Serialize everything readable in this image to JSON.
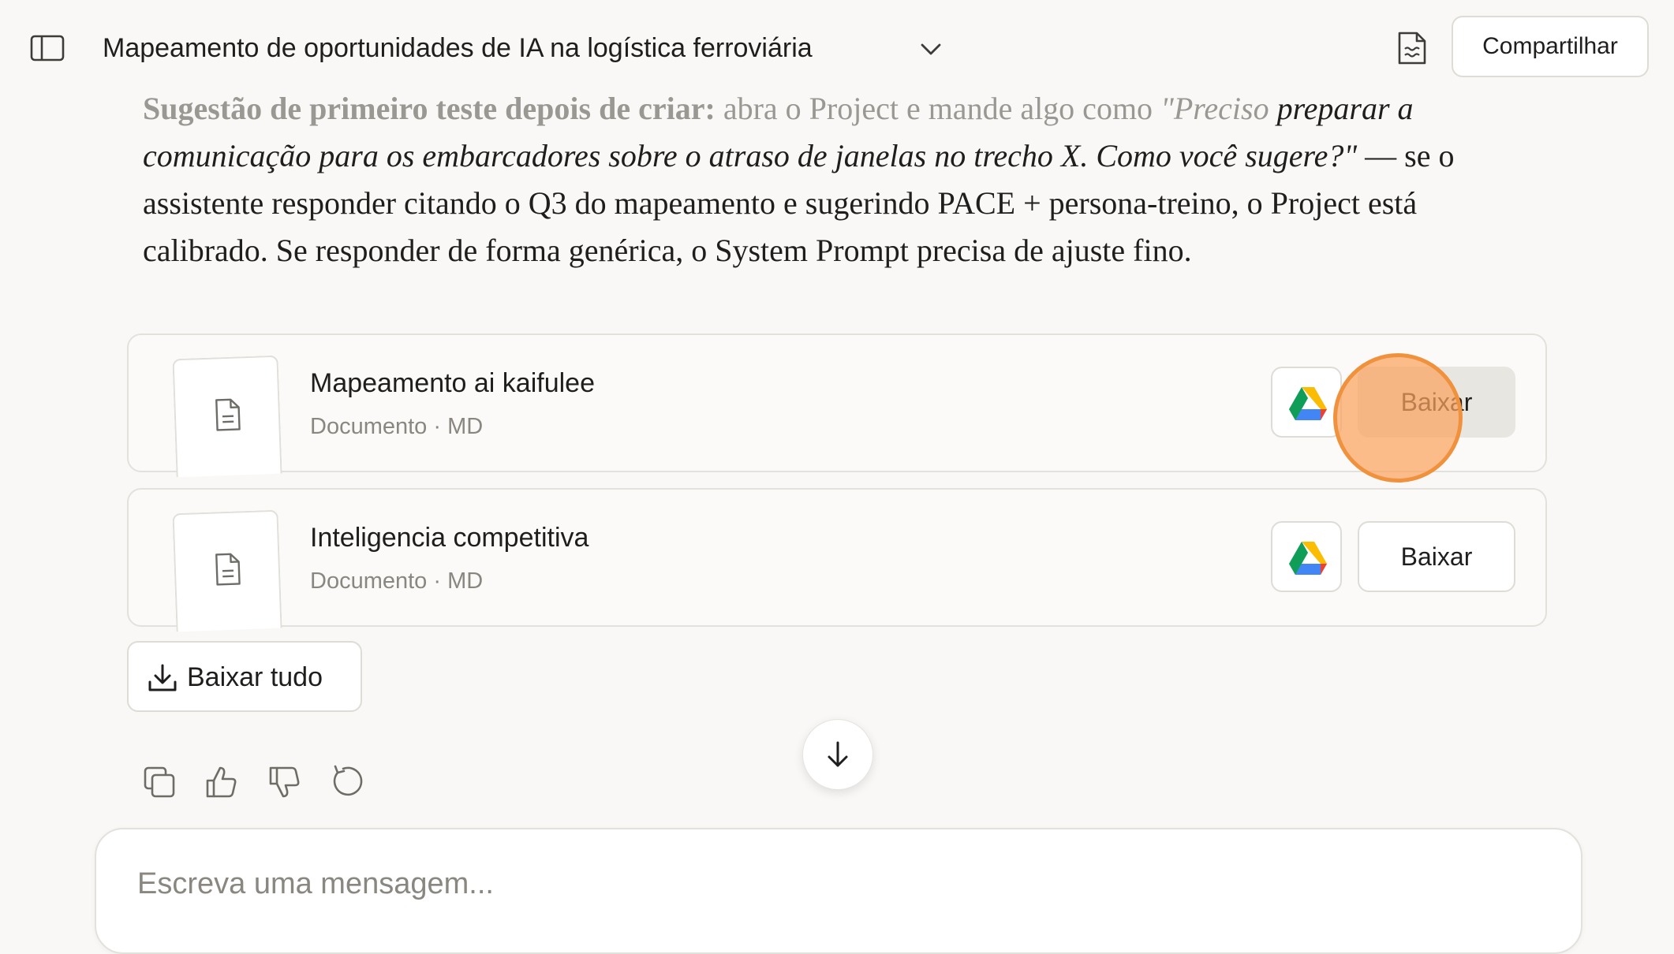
{
  "header": {
    "title": "Mapeamento de oportunidades de IA na logística ferroviária",
    "share_label": "Compartilhar"
  },
  "message": {
    "p_lead_bold": "Sugestão de primeiro teste depois de criar:",
    "p_lead_text": " abra o Project e mande algo como ",
    "p_quote_faded": "\"Preciso",
    "p_quote": " preparar a comunicação para os embarcadores sobre o atraso de janelas no trecho X. Como você sugere?\"",
    "p_rest": " — se o assistente responder citando o Q3 do mapeamento e sugerindo PACE + persona-treino, o Project está calibrado. Se responder de forma genérica, o System Prompt precisa de ajuste fino."
  },
  "files": [
    {
      "name": "Mapeamento ai kaifulee",
      "meta": "Documento · MD",
      "download_label": "Baixar"
    },
    {
      "name": "Inteligencia competitiva",
      "meta": "Documento · MD",
      "download_label": "Baixar"
    }
  ],
  "download_all_label": "Baixar tudo",
  "composer": {
    "placeholder": "Escreva uma mensagem..."
  },
  "icons": {
    "sidebar": "sidebar-toggle-icon",
    "chevron": "chevron-down-icon",
    "document": "document-icon",
    "drive": "google-drive-icon",
    "download": "download-icon",
    "copy": "copy-icon",
    "thumbs_up": "thumbs-up-icon",
    "thumbs_down": "thumbs-down-icon",
    "retry": "retry-icon",
    "arrow_down": "arrow-down-icon"
  },
  "colors": {
    "background": "#f9f8f6",
    "text": "#1f1e1d",
    "muted": "#8a8781",
    "click_marker": "#f0923d"
  }
}
